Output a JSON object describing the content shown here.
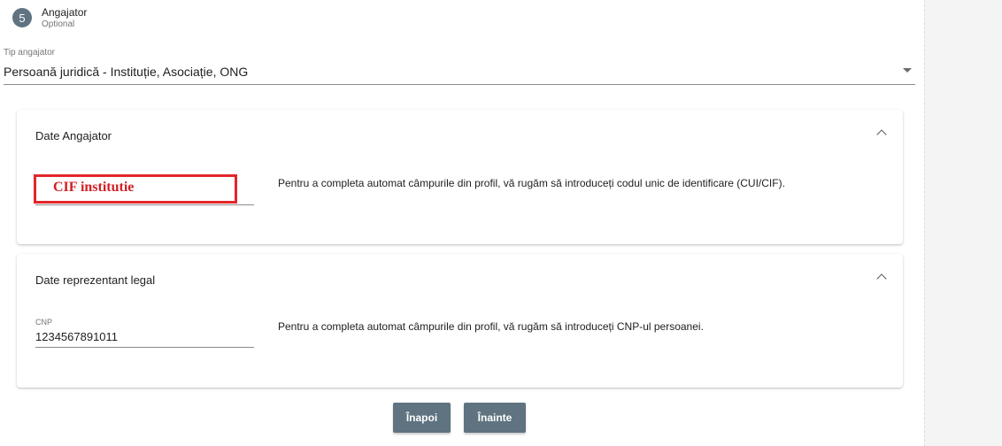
{
  "step": {
    "number": "5",
    "title": "Angajator",
    "subtitle": "Optional"
  },
  "employer_type": {
    "label": "Tip angajator",
    "value": "Persoană juridică - Instituție, Asociație, ONG"
  },
  "employer_section": {
    "title": "Date Angajator",
    "cif_placeholder": "CIF institutie",
    "help": "Pentru a completa automat câmpurile din profil, vă rugăm să introduceți codul unic de identificare (CUI/CIF)."
  },
  "representative_section": {
    "title": "Date reprezentant legal",
    "cnp_label": "CNP",
    "cnp_value": "1234567891011",
    "help": "Pentru a completa automat câmpurile din profil, vă rugăm să introduceți CNP-ul persoanei."
  },
  "buttons": {
    "back": "Înapoi",
    "next": "Înainte"
  },
  "colors": {
    "primary": "#5f7380",
    "highlight": "#e3262b"
  }
}
